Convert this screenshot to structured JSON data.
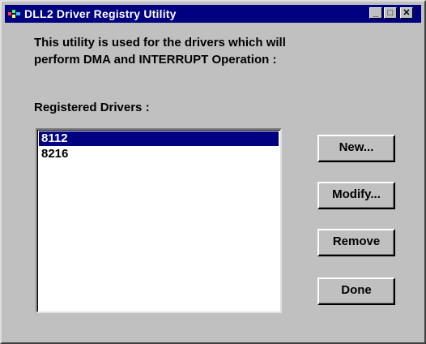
{
  "window": {
    "title": "DLL2 Driver Registry Utility",
    "minimize_glyph": "_",
    "maximize_glyph": "□",
    "close_glyph": "✕"
  },
  "description": {
    "line1": "This utility is used for the drivers which will",
    "line2": "perform DMA and INTERRUPT Operation :"
  },
  "drivers": {
    "label": "Registered Drivers :",
    "items": [
      "8112",
      "8216"
    ],
    "selected": "8112"
  },
  "buttons": {
    "new": "New...",
    "modify": "Modify...",
    "remove": "Remove",
    "done": "Done"
  },
  "colors": {
    "titlebar": "#000080",
    "face": "#c0c0c0",
    "selection": "#000080"
  }
}
